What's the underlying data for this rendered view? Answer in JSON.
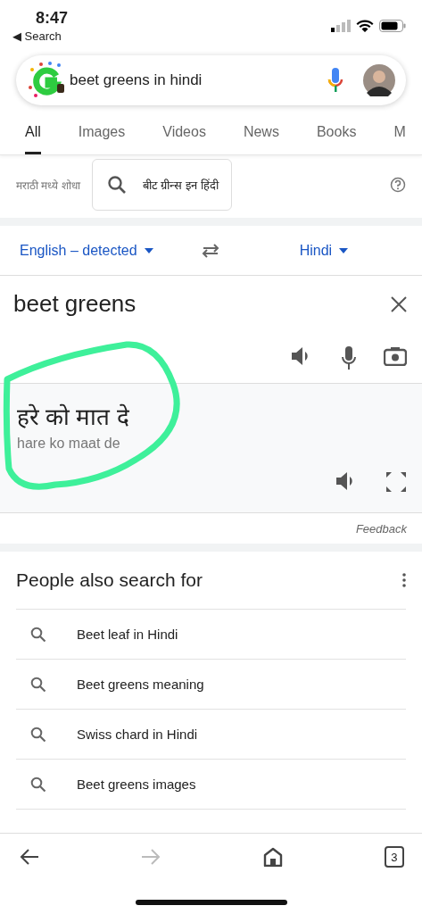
{
  "status_bar": {
    "time": "8:47",
    "back_label": "◀ Search"
  },
  "search": {
    "query": "beet greens in hindi"
  },
  "tabs": [
    {
      "label": "All",
      "selected": true
    },
    {
      "label": "Images",
      "selected": false
    },
    {
      "label": "Videos",
      "selected": false
    },
    {
      "label": "News",
      "selected": false
    },
    {
      "label": "Books",
      "selected": false
    },
    {
      "label": "M",
      "selected": false
    }
  ],
  "language_search": {
    "label": "मराठी मध्ये शोधा",
    "query": "बीट ग्रीन्स इन हिंदी"
  },
  "translate": {
    "source_lang": "English – detected",
    "target_lang": "Hindi",
    "input": "beet greens",
    "output": "हरे को मात दे",
    "transliteration": "hare ko maat de",
    "feedback": "Feedback"
  },
  "related": {
    "title": "People also search for",
    "items": [
      "Beet leaf in Hindi",
      "Beet greens meaning",
      "Swiss chard in Hindi",
      "Beet greens images"
    ]
  },
  "bottom_nav": {
    "back_disabled": false,
    "forward_disabled": true,
    "tab_count": "3"
  }
}
